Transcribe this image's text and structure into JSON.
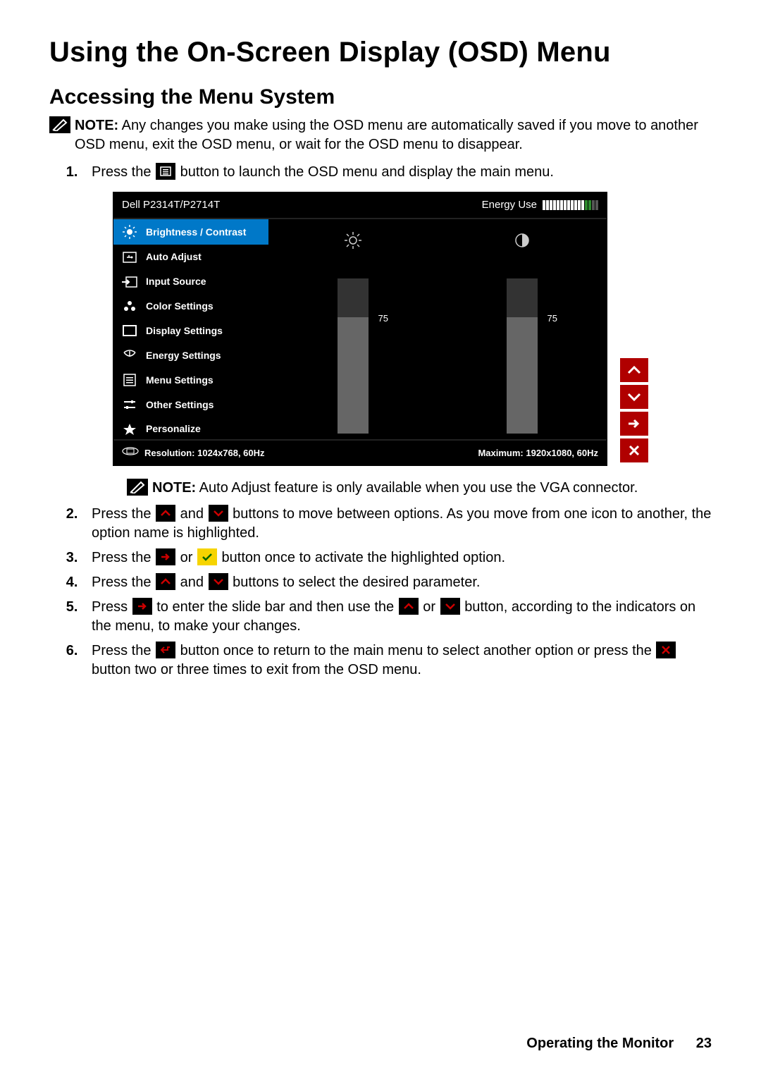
{
  "title": "Using the On-Screen Display (OSD) Menu",
  "subtitle": "Accessing the Menu System",
  "note1_label": "NOTE:",
  "note1_text": " Any changes you make using the OSD menu are automatically saved if you move to another OSD menu, exit the OSD menu, or wait for the OSD menu to disappear.",
  "step1_a": "Press the ",
  "step1_b": " button to launch the OSD menu and display the main menu.",
  "osd": {
    "model": "Dell P2314T/P2714T",
    "energy_label": "Energy Use",
    "menu": [
      {
        "icon": "bright",
        "label": "Brightness / Contrast",
        "selected": true
      },
      {
        "icon": "auto",
        "label": "Auto Adjust"
      },
      {
        "icon": "input",
        "label": "Input Source"
      },
      {
        "icon": "color",
        "label": "Color Settings"
      },
      {
        "icon": "display",
        "label": "Display Settings"
      },
      {
        "icon": "energy",
        "label": "Energy Settings"
      },
      {
        "icon": "menu",
        "label": "Menu Settings"
      },
      {
        "icon": "other",
        "label": "Other Settings"
      },
      {
        "icon": "star",
        "label": "Personalize"
      }
    ],
    "brightness_value": "75",
    "contrast_value": "75",
    "res_label": "Resolution:  1024x768, 60Hz",
    "max_label": "Maximum: 1920x1080, 60Hz"
  },
  "note2_label": "NOTE:",
  "note2_text": " Auto Adjust feature is only available when you use the VGA connector.",
  "step2_a": "Press the ",
  "step2_b": " and ",
  "step2_c": " buttons to move between options. As you move from one icon to another, the option name is highlighted.",
  "step3_a": "Press the ",
  "step3_b": " or ",
  "step3_c": " button once to activate the highlighted option.",
  "step4_a": "Press the ",
  "step4_b": " and ",
  "step4_c": " buttons to select the desired parameter.",
  "step5_a": "Press ",
  "step5_b": " to enter the slide bar and then use the ",
  "step5_c": " or ",
  "step5_d": " button, according to the indicators on the menu, to make your changes.",
  "step6_a": "Press the ",
  "step6_b": " button once to return to the main menu to select another option or press the ",
  "step6_c": " button two or three times to exit from the OSD menu.",
  "footer_text": "Operating the Monitor",
  "page_number": "23"
}
